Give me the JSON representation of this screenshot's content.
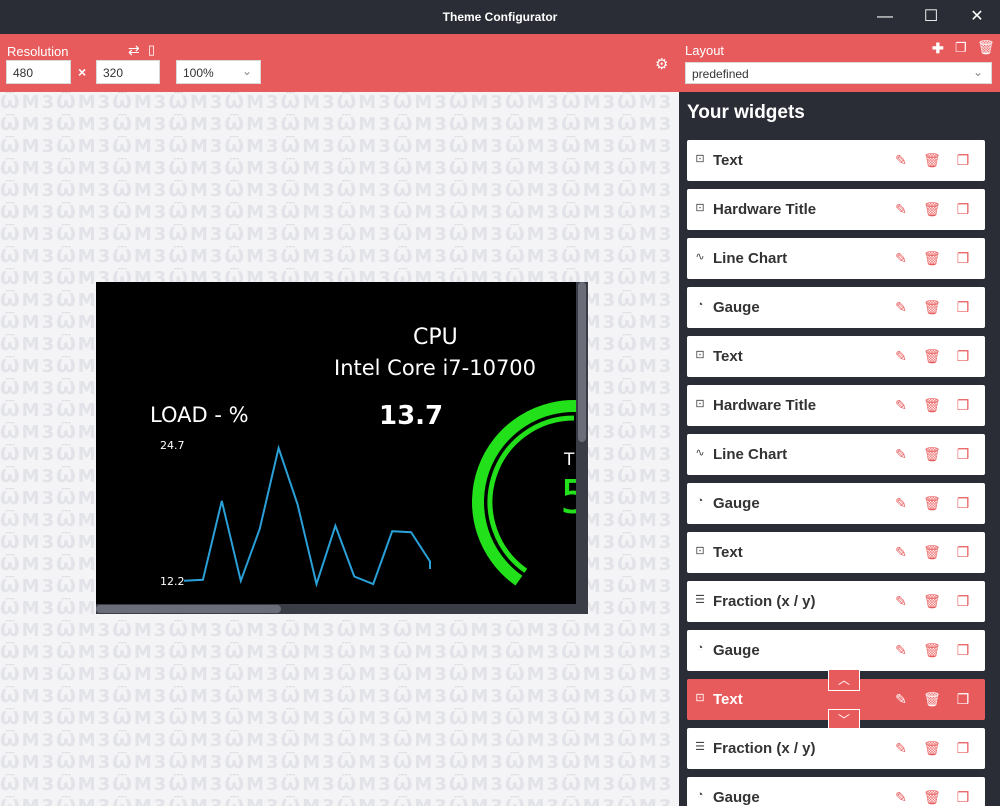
{
  "window": {
    "title": "Theme Configurator",
    "minimize": "—",
    "maximize": "☐",
    "close": "✕"
  },
  "toolbar": {
    "resolution_label": "Resolution",
    "width_value": "480",
    "times": "×",
    "height_value": "320",
    "zoom_value": "100%",
    "layout_label": "Layout",
    "layout_value": "predefined"
  },
  "preview": {
    "cpu_title": "CPU",
    "cpu_name": "Intel Core i7-10700",
    "load_label": "LOAD - %",
    "load_value": "13.7",
    "chart_max": "24.7",
    "chart_min": "12.2",
    "gauge_label_partial": "TE",
    "gauge_value_partial": "5",
    "gauge_color": "#22e01a",
    "chart_color": "#2aa0d8"
  },
  "chart_data": {
    "type": "line",
    "series": [
      {
        "values": [
          12.4,
          12.5,
          19.8,
          12.4,
          17.2,
          24.7,
          19.5,
          12.1,
          17.5,
          12.8,
          12.1,
          17.0,
          16.9,
          14.2
        ]
      }
    ],
    "ylim": [
      12.2,
      24.7
    ]
  },
  "panel": {
    "title": "Your widgets",
    "widgets": [
      {
        "icon": "text-icon",
        "name": "Text",
        "selected": false
      },
      {
        "icon": "text-icon",
        "name": "Hardware Title",
        "selected": false
      },
      {
        "icon": "line-chart-icon",
        "name": "Line Chart",
        "selected": false
      },
      {
        "icon": "gauge-icon",
        "name": "Gauge",
        "selected": false
      },
      {
        "icon": "text-icon",
        "name": "Text",
        "selected": false
      },
      {
        "icon": "text-icon",
        "name": "Hardware Title",
        "selected": false
      },
      {
        "icon": "line-chart-icon",
        "name": "Line Chart",
        "selected": false
      },
      {
        "icon": "gauge-icon",
        "name": "Gauge",
        "selected": false
      },
      {
        "icon": "text-icon",
        "name": "Text",
        "selected": false
      },
      {
        "icon": "database-icon",
        "name": "Fraction (x / y)",
        "selected": false
      },
      {
        "icon": "gauge-icon",
        "name": "Gauge",
        "selected": false
      },
      {
        "icon": "text-icon",
        "name": "Text",
        "selected": true
      },
      {
        "icon": "database-icon",
        "name": "Fraction (x / y)",
        "selected": false
      },
      {
        "icon": "gauge-icon",
        "name": "Gauge",
        "selected": false
      }
    ]
  },
  "colors": {
    "accent": "#e85b5c",
    "dark": "#2b2d36",
    "canvas_bg": "#f4f4f6"
  }
}
